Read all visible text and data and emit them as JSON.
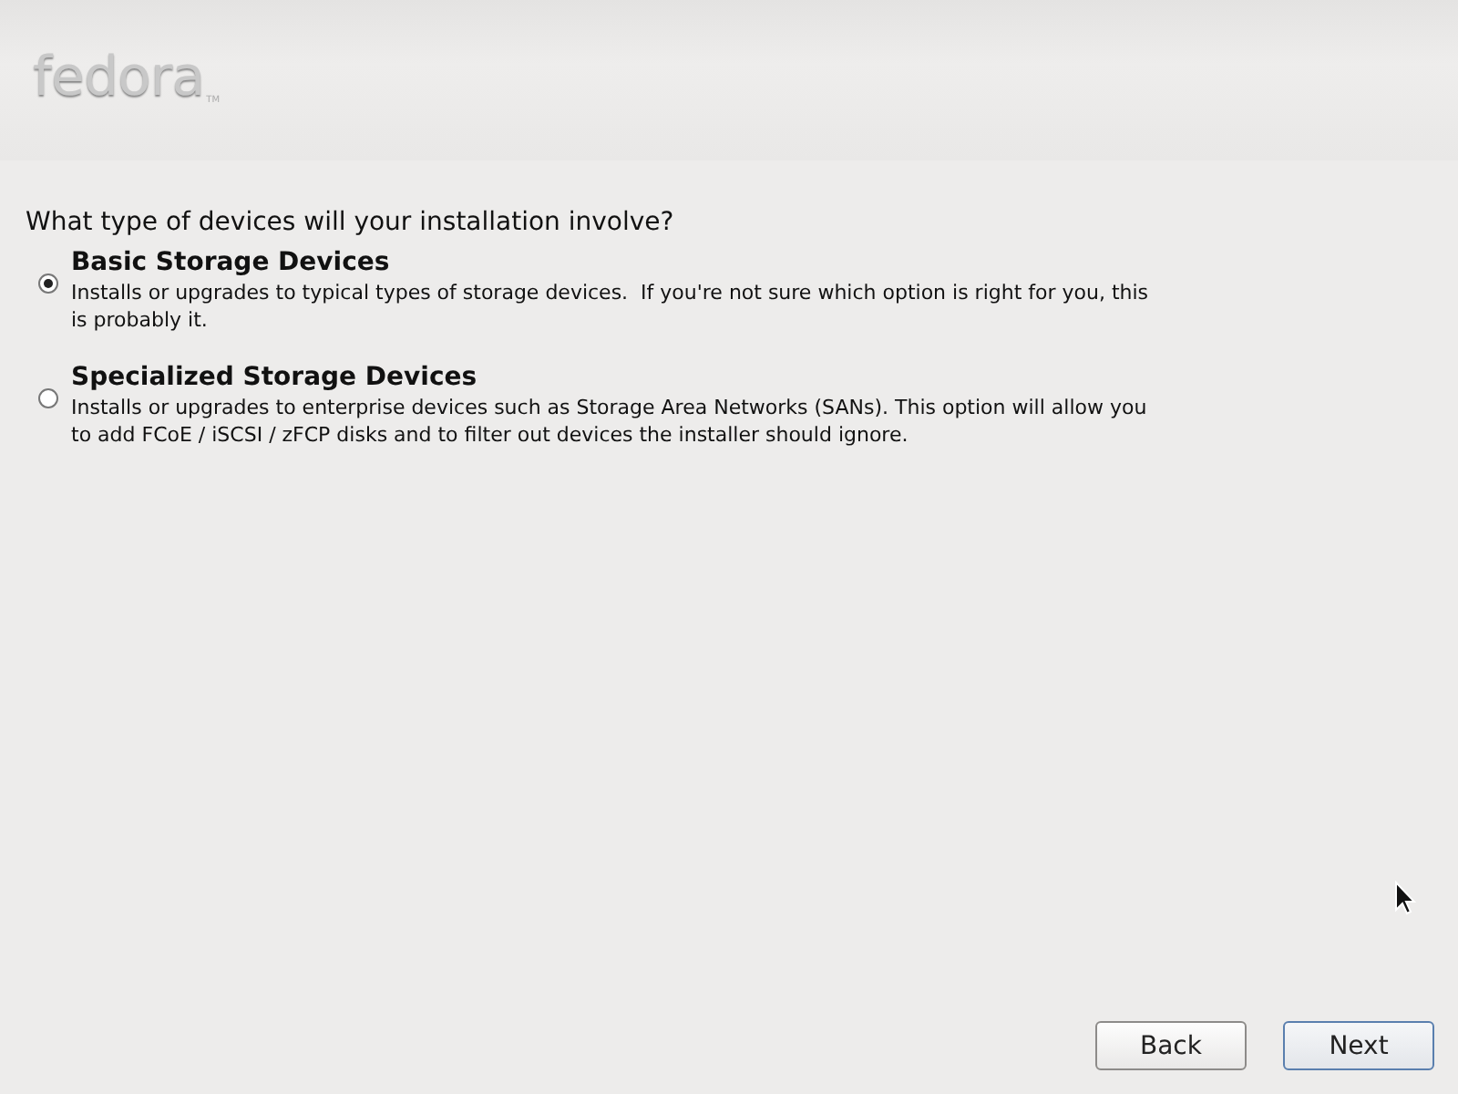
{
  "header": {
    "logo": "fedora",
    "trademark": "TM"
  },
  "question": "What type of devices will your installation involve?",
  "options": [
    {
      "title": "Basic Storage Devices",
      "description": "Installs or upgrades to typical types of storage devices.  If you're not sure which option is right for you, this is probably it.",
      "selected": true
    },
    {
      "title": "Specialized Storage Devices",
      "description": "Installs or upgrades to enterprise devices such as Storage Area Networks (SANs). This option will allow you to add FCoE / iSCSI / zFCP disks and to filter out devices the installer should ignore.",
      "selected": false
    }
  ],
  "buttons": [
    {
      "label": "Back",
      "default": false
    },
    {
      "label": "Next",
      "default": true
    }
  ]
}
